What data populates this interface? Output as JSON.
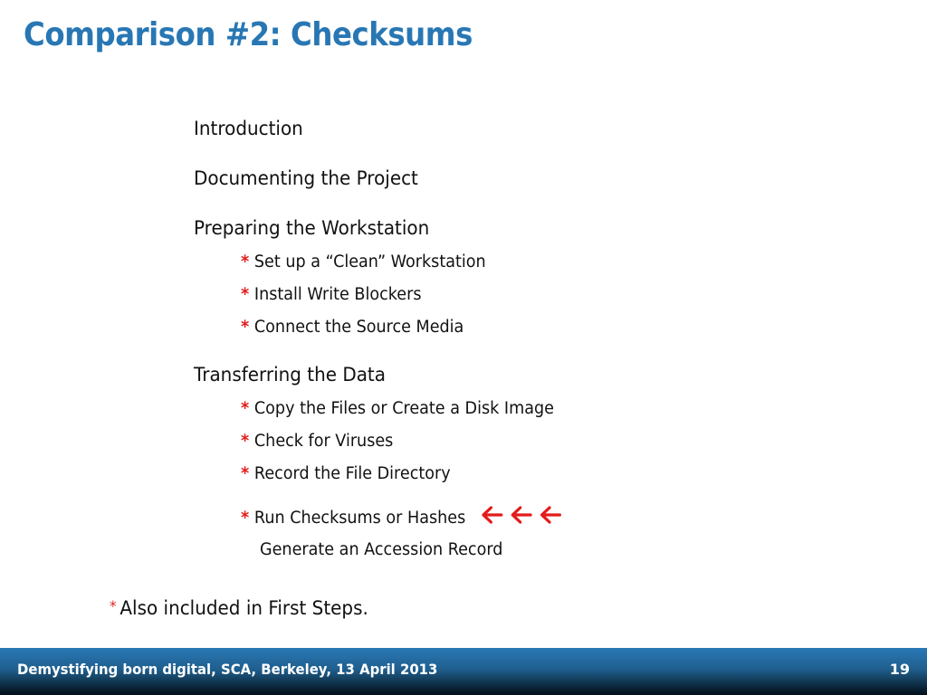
{
  "slide": {
    "title": "Comparison #2: Checksums",
    "accent_color": "#2877b4",
    "marker_color": "#e41b1b",
    "sections": [
      {
        "heading": "Introduction",
        "items": []
      },
      {
        "heading": "Documenting the Project",
        "items": []
      },
      {
        "heading": "Preparing the Workstation",
        "items": [
          {
            "marker": "*",
            "text": "Set up a “Clean” Workstation"
          },
          {
            "marker": "*",
            "text": "Install Write Blockers"
          },
          {
            "marker": "*",
            "text": "Connect the Source Media"
          }
        ]
      },
      {
        "heading": "Transferring the Data",
        "items": [
          {
            "marker": "*",
            "text": "Copy the Files or Create a Disk Image"
          },
          {
            "marker": "*",
            "text": "Check for Viruses"
          },
          {
            "marker": "*",
            "text": "Record the File Directory"
          },
          {
            "marker": "*",
            "text": "Run Checksums or Hashes",
            "highlight_icons": [
              "arrow-left-icon",
              "arrow-left-icon",
              "arrow-left-icon"
            ]
          },
          {
            "marker": "",
            "text": "Generate an Accession Record"
          }
        ]
      }
    ],
    "footnote": {
      "marker": "*",
      "text": "Also included in First Steps."
    }
  },
  "footer": {
    "text": "Demystifying born digital, SCA, Berkeley, 13 April 2013",
    "page_number": "19"
  }
}
